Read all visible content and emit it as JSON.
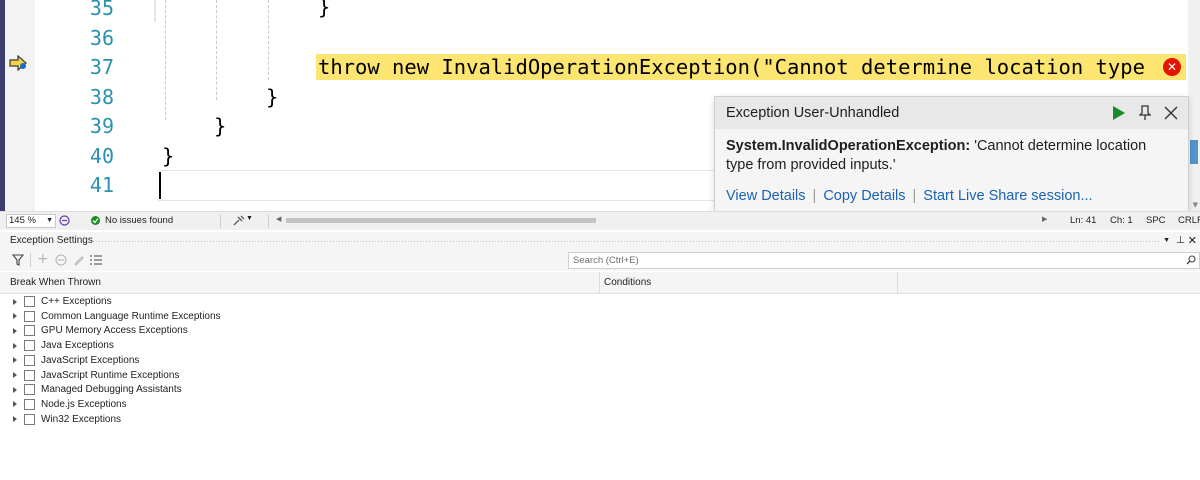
{
  "editor": {
    "line_numbers": [
      "35",
      "36",
      "37",
      "38",
      "39",
      "40",
      "41"
    ],
    "code_lines": [
      {
        "text": "}"
      },
      {
        "text": ""
      },
      {
        "text": "throw new InvalidOperationException(\"Cannot determine location type"
      },
      {
        "text": "}"
      },
      {
        "text": "}"
      },
      {
        "text": "}"
      },
      {
        "text": ""
      }
    ],
    "highlight_color": "#fce570",
    "line_number_color": "#2b91af"
  },
  "exception_popup": {
    "title": "Exception User-Unhandled",
    "exception_type": "System.InvalidOperationException:",
    "message_line1": "'Cannot determine location",
    "message_line2": "type from provided inputs.'",
    "links": [
      "View Details",
      "Copy Details",
      "Start Live Share session..."
    ],
    "link_separator": "|",
    "continue_icon": "play-icon",
    "pin_icon": "pin-icon",
    "close_icon": "close-icon"
  },
  "status_bar": {
    "zoom": "145 %",
    "issues": "No issues found",
    "line": "Ln: 41",
    "char": "Ch: 1",
    "whitespace": "SPC",
    "line_ending": "CRLF"
  },
  "exception_settings": {
    "title": "Exception Settings",
    "search_placeholder": "Search (Ctrl+E)",
    "columns": [
      "Break When Thrown",
      "Conditions"
    ],
    "categories": [
      "C++ Exceptions",
      "Common Language Runtime Exceptions",
      "GPU Memory Access Exceptions",
      "Java Exceptions",
      "JavaScript Exceptions",
      "JavaScript Runtime Exceptions",
      "Managed Debugging Assistants",
      "Node.js Exceptions",
      "Win32 Exceptions"
    ]
  }
}
